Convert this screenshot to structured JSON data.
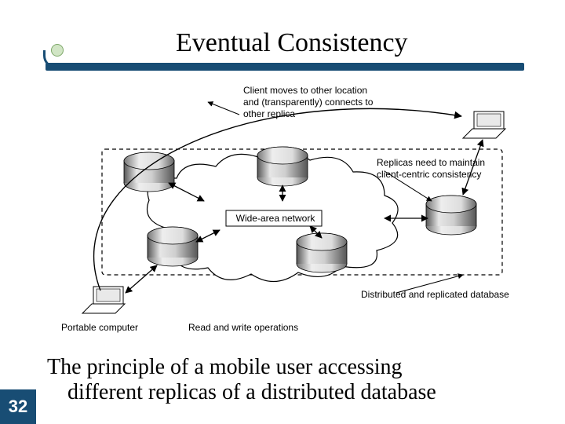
{
  "slide": {
    "title": "Eventual Consistency",
    "page_number": "32",
    "caption_line1": "The principle of a mobile user accessing",
    "caption_line2": "different replicas of a distributed database"
  },
  "diagram": {
    "labels": {
      "client_moves_l1": "Client moves to other location",
      "client_moves_l2": "and (transparently) connects to",
      "client_moves_l3": "other replica",
      "replicas_l1": "Replicas need to maintain",
      "replicas_l2": "client-centric consistency",
      "wan": "Wide-area network",
      "distributed_db": "Distributed and replicated database",
      "portable": "Portable computer",
      "rw_ops": "Read and write operations"
    }
  }
}
